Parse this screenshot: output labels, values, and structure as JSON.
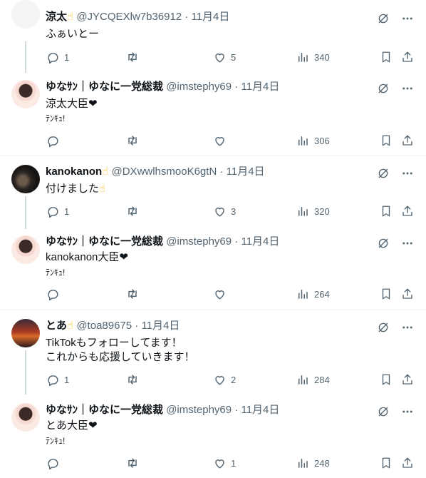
{
  "tweets": [
    {
      "name": "涼太",
      "name_emoji": "☝",
      "handle": "@JYCQEXlw7b36912",
      "date": "11月4日",
      "text": "ふぁいとー",
      "replies": "1",
      "likes": "5",
      "views": "340",
      "avatar_color": "#f2f2f2"
    },
    {
      "name": "ゆなｻﾝ｜ゆなに一党総裁",
      "handle": "@imstephy69",
      "date": "11月4日",
      "text": "涼太大臣",
      "text_tail": "❤",
      "sub": "ﾃﾝｷｭ!",
      "views": "306",
      "avatar_color": "#f7dcd8"
    },
    {
      "name": "kanokanon",
      "name_emoji": "☝",
      "handle": "@DXwwlhsmooK6gtN",
      "date": "11月4日",
      "text": "付けました",
      "text_emoji": "☝",
      "replies": "1",
      "likes": "3",
      "views": "320",
      "avatar_color": "#2b2b2b"
    },
    {
      "name": "ゆなｻﾝ｜ゆなに一党総裁",
      "handle": "@imstephy69",
      "date": "11月4日",
      "text": "kanokanon大臣",
      "text_tail": "❤",
      "sub": "ﾃﾝｷｭ!",
      "views": "264",
      "avatar_color": "#f7dcd8"
    },
    {
      "name": "とあ",
      "name_emoji": "☝",
      "handle": "@toa89675",
      "date": "11月4日",
      "text": "TikTokもフォローしてます！",
      "text2": "これからも応援していきます！",
      "replies": "1",
      "likes": "2",
      "views": "284",
      "avatar_color": "#b5472f"
    },
    {
      "name": "ゆなｻﾝ｜ゆなに一党総裁",
      "handle": "@imstephy69",
      "date": "11月4日",
      "text": "とあ大臣",
      "text_tail": "❤",
      "sub": "ﾃﾝｷｭ!",
      "likes": "1",
      "views": "248",
      "avatar_color": "#f7dcd8"
    }
  ],
  "icons": {
    "reply": "reply-icon",
    "retweet": "retweet-icon",
    "like": "heart-icon",
    "views": "views-icon",
    "bookmark": "bookmark-icon",
    "share": "share-icon",
    "grok": "grok-icon",
    "more": "more-icon"
  },
  "colors": {
    "text": "#0f1419",
    "meta": "#536471",
    "separator": "#eff3f4",
    "thread_line": "#cfd9de"
  }
}
